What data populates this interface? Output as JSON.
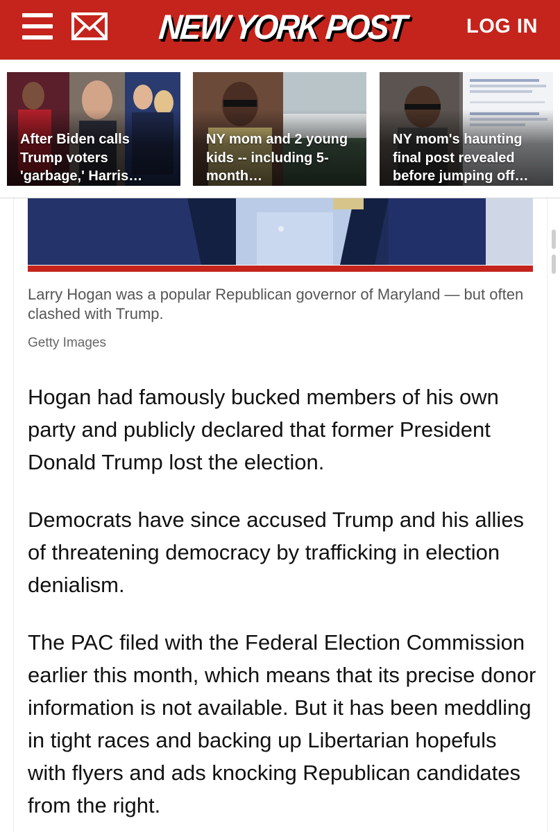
{
  "header": {
    "brand": "NEW YORK POST",
    "login_label": "LOG IN",
    "menu_icon": "hamburger-menu-icon",
    "mail_icon": "envelope-icon",
    "brand_color": "#c4241c"
  },
  "trending": [
    {
      "caption": "After Biden calls Trump voters 'garbage,' Harris…"
    },
    {
      "caption": "NY mom and 2 young kids -- including 5-month…"
    },
    {
      "caption": "NY mom's haunting final post revealed before jumping off…"
    }
  ],
  "article": {
    "photo_caption": "Larry Hogan was a popular Republican governor of Maryland — but often clashed with Trump.",
    "photo_credit": "Getty Images",
    "paragraphs": [
      "Hogan had famously bucked members of his own party and publicly declared that former President Donald Trump lost the election.",
      "Democrats have since accused Trump and his allies of threatening democracy by trafficking in election denialism.",
      "The PAC filed with the Federal Election Commission earlier this month, which means that its precise donor information is not available. But it has been meddling in tight races and backing up Libertarian hopefuls with flyers and ads knocking Republican candidates from the right."
    ]
  }
}
